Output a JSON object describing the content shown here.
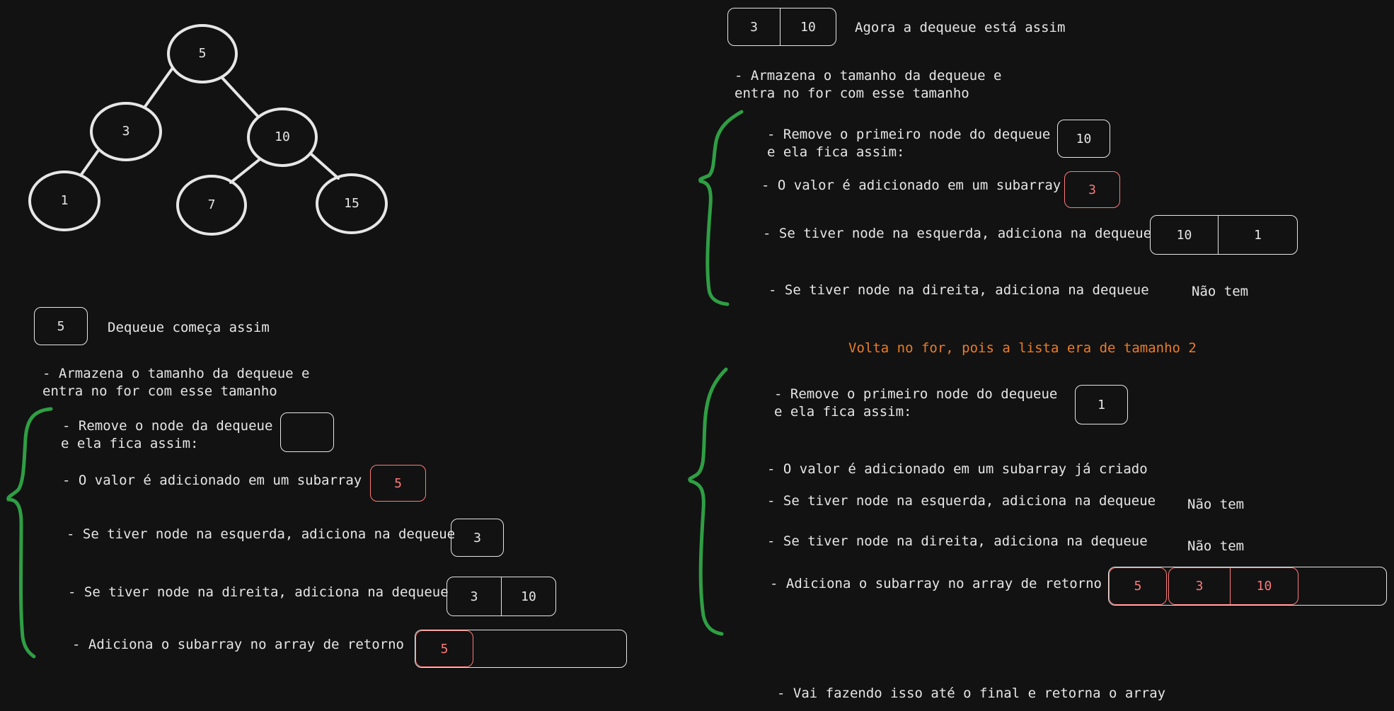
{
  "tree": {
    "nodes": [
      {
        "id": "n5",
        "label": "5"
      },
      {
        "id": "n3",
        "label": "3"
      },
      {
        "id": "n10",
        "label": "10"
      },
      {
        "id": "n1",
        "label": "1"
      },
      {
        "id": "n7",
        "label": "7"
      },
      {
        "id": "n15",
        "label": "15"
      }
    ]
  },
  "left": {
    "deque_start": {
      "value": "5",
      "caption": "Dequeue começa assim"
    },
    "store_line1": "- Armazena o tamanho da dequeue e",
    "store_line2": "entra no for com esse tamanho",
    "remove_line1": "- Remove o node da dequeue",
    "remove_line2": "e ela fica assim:",
    "remove_box": "",
    "value_added": "- O valor é adicionado em um subarray",
    "subarray_value": "5",
    "left_node": "- Se tiver node na esquerda, adiciona na dequeue",
    "left_node_box": "3",
    "right_node": "- Se tiver node na direita, adiciona na dequeue",
    "right_node_cells": [
      "3",
      "10"
    ],
    "add_subarray": "- Adiciona o subarray no array de retorno",
    "return_cells": [
      "5"
    ]
  },
  "right": {
    "deque_now": {
      "cells": [
        "3",
        "10"
      ],
      "caption": "Agora a dequeue está assim"
    },
    "store_line1": "- Armazena o tamanho da dequeue e",
    "store_line2": "entra no for com esse tamanho",
    "step1": {
      "remove_line1": "- Remove o primeiro node do dequeue",
      "remove_line2": "e ela fica assim:",
      "remove_box": "10",
      "value_added": "- O valor é adicionado em um subarray",
      "subarray_value": "3",
      "left_node": "- Se tiver node na esquerda, adiciona na dequeue",
      "left_node_cells": [
        "10",
        "1"
      ],
      "right_node": "- Se tiver node na direita, adiciona na dequeue",
      "right_node_result": "Não tem"
    },
    "back_to_for": "Volta no for, pois a lista era de tamanho 2",
    "step2": {
      "remove_line1": "- Remove o primeiro node do dequeue",
      "remove_line2": "e ela fica assim:",
      "remove_box": "1",
      "value_added": "- O valor é adicionado em um subarray já criado",
      "left_node": "- Se tiver node na esquerda, adiciona na dequeue",
      "left_node_result": "Não tem",
      "right_node": "- Se tiver node na direita, adiciona na dequeue",
      "right_node_result": "Não tem",
      "add_subarray": "- Adiciona o subarray no array de retorno",
      "return_first": "5",
      "return_second": [
        "3",
        "10"
      ]
    },
    "final": "- Vai fazendo isso até o final e retorna o array"
  },
  "colors": {
    "background": "#121212",
    "stroke": "#e6e6e6",
    "brace": "#2f9e44",
    "red": "#ff7a7a",
    "orange": "#e87d2a"
  }
}
